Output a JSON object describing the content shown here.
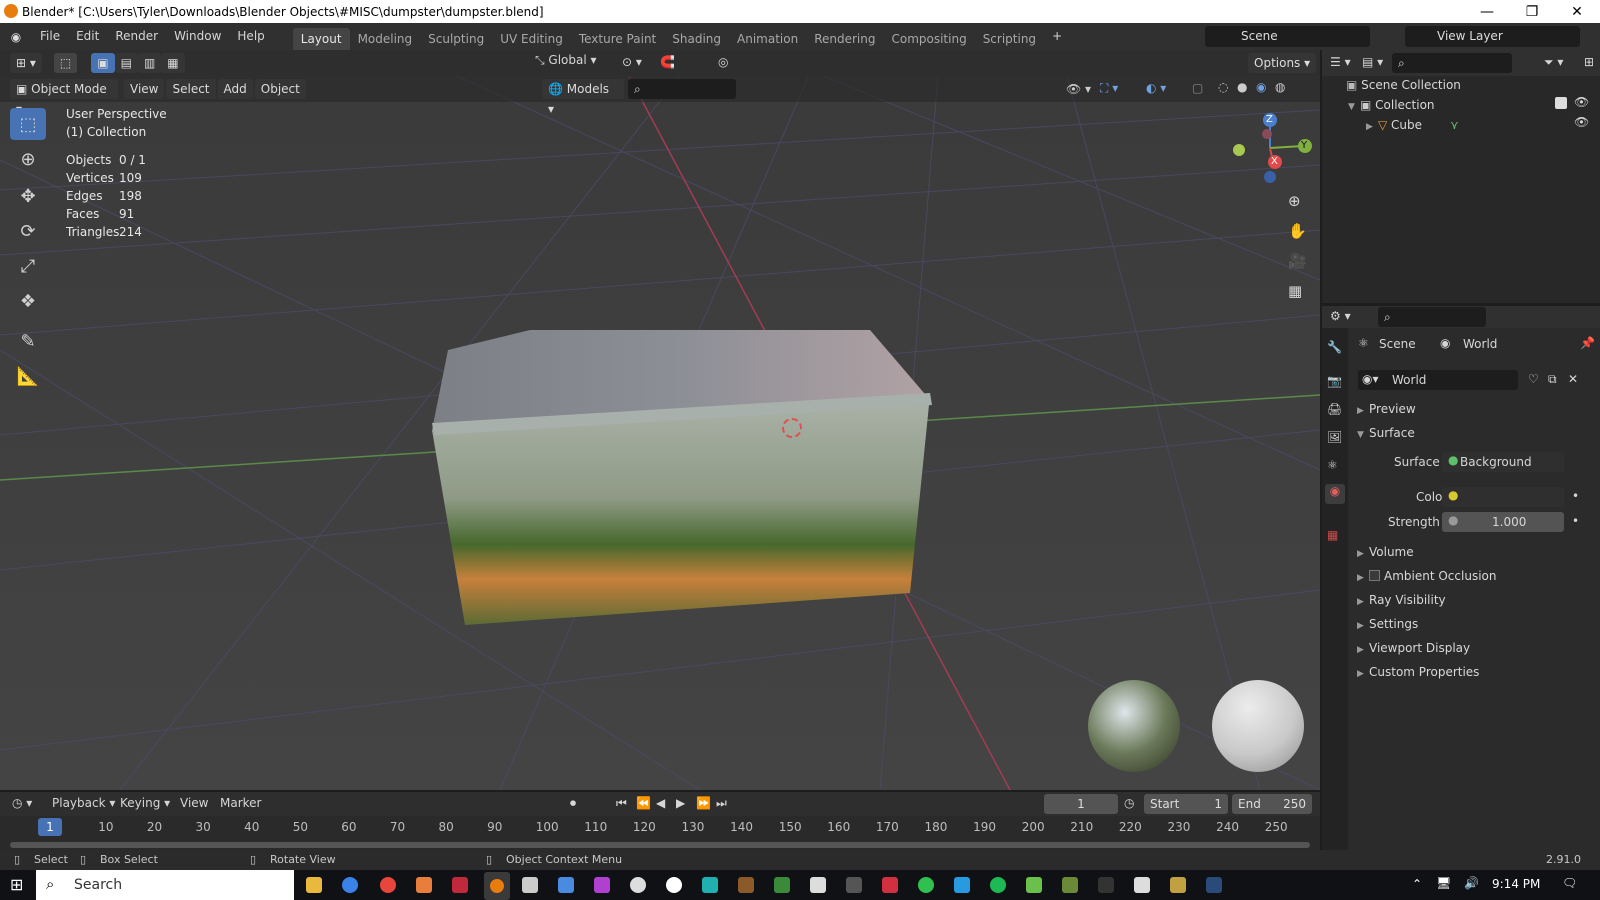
{
  "window": {
    "title": "Blender* [C:\\Users\\Tyler\\Downloads\\Blender Objects\\#MISC\\dumpster\\dumpster.blend]",
    "minimize": "—",
    "maximize": "❐",
    "close": "✕"
  },
  "menu": [
    "File",
    "Edit",
    "Render",
    "Window",
    "Help"
  ],
  "workspaces": [
    "Layout",
    "Modeling",
    "Sculpting",
    "UV Editing",
    "Texture Paint",
    "Shading",
    "Animation",
    "Rendering",
    "Compositing",
    "Scripting"
  ],
  "workspace_add": "+",
  "scene_field": "Scene",
  "viewlayer_field": "View Layer",
  "viewport": {
    "transform_orientation": "Global",
    "options_label": "Options",
    "mode": "Object Mode",
    "header_menus": [
      "View",
      "Select",
      "Add",
      "Object"
    ],
    "collection_dropdown": "Models",
    "overlay_title": "User Perspective",
    "overlay_collection": "(1) Collection",
    "stats": [
      {
        "label": "Objects",
        "value": "0 / 1"
      },
      {
        "label": "Vertices",
        "value": "109"
      },
      {
        "label": "Edges",
        "value": "198"
      },
      {
        "label": "Faces",
        "value": "91"
      },
      {
        "label": "Triangles",
        "value": "214"
      }
    ],
    "gizmo_axes": {
      "z": "Z",
      "y": "Y",
      "x": "X"
    }
  },
  "outliner": {
    "root": "Scene Collection",
    "collection": "Collection",
    "object": "Cube"
  },
  "properties": {
    "breadcrumb_scene": "Scene",
    "breadcrumb_world": "World",
    "world_name": "World",
    "panels": {
      "preview": "Preview",
      "surface": "Surface",
      "volume": "Volume",
      "ao": "Ambient Occlusion",
      "ray": "Ray Visibility",
      "settings": "Settings",
      "viewport_display": "Viewport Display",
      "custom": "Custom Properties"
    },
    "surface_label": "Surface",
    "surface_value": "Background",
    "color_label": "Color",
    "strength_label": "Strength",
    "strength_value": "1.000"
  },
  "timeline": {
    "menus": [
      "Playback",
      "Keying",
      "View",
      "Marker"
    ],
    "current_frame": "1",
    "start_label": "Start",
    "start_value": "1",
    "end_label": "End",
    "end_value": "250",
    "ruler": [
      "1",
      "10",
      "20",
      "30",
      "40",
      "50",
      "60",
      "70",
      "80",
      "90",
      "100",
      "110",
      "120",
      "130",
      "140",
      "150",
      "160",
      "170",
      "180",
      "190",
      "200",
      "210",
      "220",
      "230",
      "240",
      "250"
    ]
  },
  "statusbar": {
    "select": "Select",
    "box_select": "Box Select",
    "rotate_view": "Rotate View",
    "context_menu": "Object Context Menu",
    "version": "2.91.0"
  },
  "taskbar": {
    "search_placeholder": "Search",
    "time": "9:14 PM"
  },
  "colors": {
    "accent": "#4772b3",
    "selected_frame": "#4772b3",
    "orange": "#e87d0d"
  }
}
